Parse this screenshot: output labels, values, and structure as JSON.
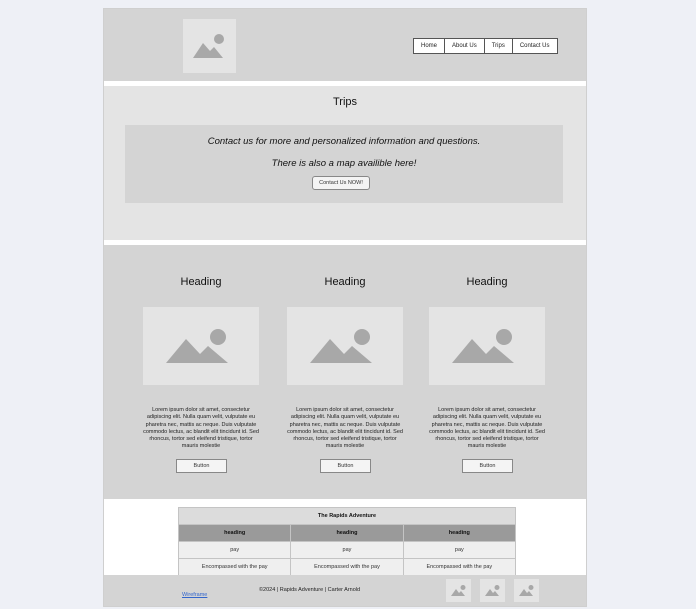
{
  "nav": {
    "items": [
      "Home",
      "About Us",
      "Trips",
      "Contact Us"
    ]
  },
  "trips": {
    "title": "Trips",
    "contact_line1": "Contact us for more and personalized information and questions.",
    "contact_line2": "There is also a map availible here!",
    "contact_button": "Contact Us NOW!"
  },
  "columns": [
    {
      "heading": "Heading",
      "text": "Lorem ipsum dolor sit amet, consectetur adipiscing elit. Nulla quam velit, vulputate eu pharetra nec, mattis ac neque. Duis vulputate commodo lectus, ac blandit elit tincidunt id. Sed rhoncus, tortor sed eleifend tristique, tortor mauris molestie",
      "button": "Button"
    },
    {
      "heading": "Heading",
      "text": "Lorem ipsum dolor sit amet, consectetur adipiscing elit. Nulla quam velit, vulputate eu pharetra nec, mattis ac neque. Duis vulputate commodo lectus, ac blandit elit tincidunt id. Sed rhoncus, tortor sed eleifend tristique, tortor mauris molestie",
      "button": "Button"
    },
    {
      "heading": "Heading",
      "text": "Lorem ipsum dolor sit amet, consectetur adipiscing elit. Nulla quam velit, vulputate eu pharetra nec, mattis ac neque. Duis vulputate commodo lectus, ac blandit elit tincidunt id. Sed rhoncus, tortor sed eleifend tristique, tortor mauris molestie",
      "button": "Button"
    }
  ],
  "table": {
    "title": "The Rapids Adventure",
    "headers": [
      "heading",
      "heading",
      "heading"
    ],
    "rows": [
      [
        "pay",
        "pay",
        "pay"
      ],
      [
        "Encompassed with the pay",
        "Encompassed with the pay",
        "Encompassed with the pay"
      ]
    ]
  },
  "footer": {
    "link": "Wireframe",
    "copyright": "©2024 | Rapids Adventure | Carter Arnold"
  },
  "icons": {
    "image_placeholder": "image-placeholder-icon"
  },
  "colors": {
    "panel": "#d4d4d4",
    "panel_light": "#e4e4e4",
    "placeholder_glyph": "#a8a8a8",
    "table_header": "#9a9a9a",
    "link": "#3366cc"
  }
}
